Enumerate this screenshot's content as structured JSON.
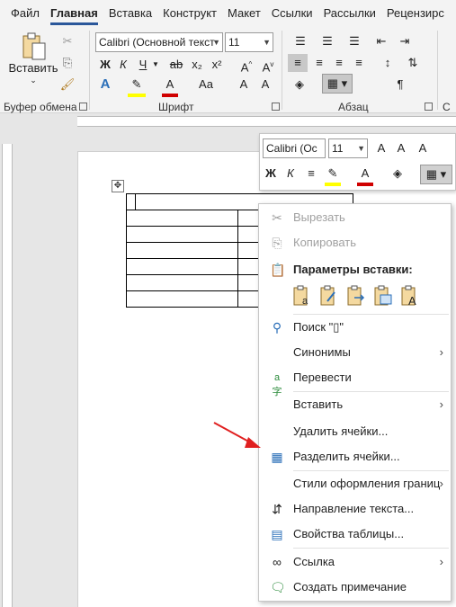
{
  "tabs": [
    "Файл",
    "Главная",
    "Вставка",
    "Конструкт",
    "Макет",
    "Ссылки",
    "Рассылки",
    "Рецензирс"
  ],
  "ribbon": {
    "clipboard": {
      "paste_label": "Вставить",
      "group_label": "Буфер обмена"
    },
    "font": {
      "font_name": "Calibri (Основной текст",
      "font_size": "11",
      "group_label": "Шрифт",
      "bold": "Ж",
      "italic": "К",
      "underline": "Ч",
      "strike": "ab",
      "sub": "x₂",
      "sup": "x²",
      "aa": "Aa"
    },
    "paragraph": {
      "group_label": "Абзац",
      "pilcrow": "¶"
    },
    "styles": {
      "group_label": "С"
    }
  },
  "mini_toolbar": {
    "font_name": "Calibri (Ос",
    "font_size": "11",
    "bold": "Ж",
    "italic": "К"
  },
  "context_menu": {
    "cut": "Вырезать",
    "copy": "Копировать",
    "paste_options": "Параметры вставки:",
    "search": "Поиск \"▯\"",
    "synonyms": "Синонимы",
    "translate": "Перевести",
    "insert": "Вставить",
    "delete_cells": "Удалить ячейки...",
    "split_cells": "Разделить ячейки...",
    "border_styles": "Стили оформления границ",
    "text_direction": "Направление текста...",
    "table_properties": "Свойства таблицы...",
    "link": "Ссылка",
    "new_comment": "Создать примечание"
  },
  "colors": {
    "accent": "#2b579a",
    "arrow": "#e02020",
    "highlight": "#ffff00",
    "font_color": "#d00000"
  }
}
